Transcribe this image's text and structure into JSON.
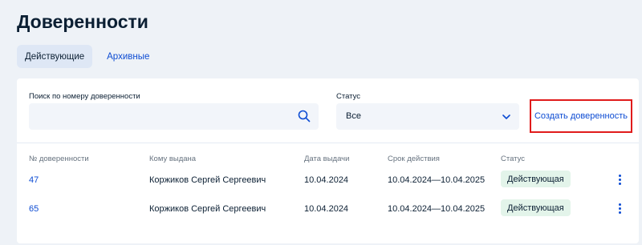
{
  "page": {
    "title": "Доверенности"
  },
  "tabs": [
    {
      "label": "Действующие",
      "active": true
    },
    {
      "label": "Архивные",
      "active": false
    }
  ],
  "filters": {
    "search_label": "Поиск по номеру доверенности",
    "search_value": "",
    "status_label": "Статус",
    "status_value": "Все",
    "create_button": "Создать доверенность"
  },
  "table": {
    "headers": [
      "№ доверенности",
      "Кому выдана",
      "Дата выдачи",
      "Срок действия",
      "Статус"
    ],
    "rows": [
      {
        "number": "47",
        "issued_to": "Коржиков Сергей Сергеевич",
        "issue_date": "10.04.2024",
        "validity": "10.04.2024—10.04.2025",
        "status": "Действующая"
      },
      {
        "number": "65",
        "issued_to": "Коржиков Сергей Сергеевич",
        "issue_date": "10.04.2024",
        "validity": "10.04.2024—10.04.2025",
        "status": "Действующая"
      }
    ]
  },
  "colors": {
    "accent": "#0d4cd3",
    "highlight_border": "#e01b1b",
    "badge_bg": "#e3f4ea",
    "page_bg": "#eef2f7"
  },
  "icons": {
    "search": "search-icon",
    "dropdown": "chevron-down-icon",
    "row_menu": "more-vertical-icon"
  }
}
